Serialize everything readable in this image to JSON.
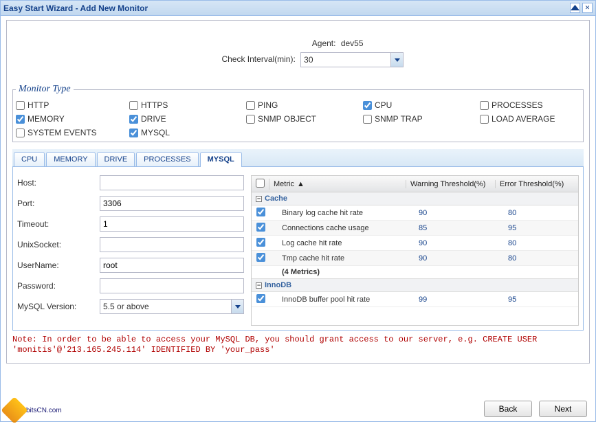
{
  "window": {
    "title": "Easy Start Wizard - Add New Monitor"
  },
  "agent": {
    "label": "Agent:",
    "value": "dev55",
    "interval_label": "Check Interval(min):",
    "interval_value": "30"
  },
  "monitor_type": {
    "legend": "Monitor Type",
    "items": [
      {
        "label": "HTTP",
        "checked": false
      },
      {
        "label": "HTTPS",
        "checked": false
      },
      {
        "label": "PING",
        "checked": false
      },
      {
        "label": "CPU",
        "checked": true
      },
      {
        "label": "PROCESSES",
        "checked": false
      },
      {
        "label": "MEMORY",
        "checked": true
      },
      {
        "label": "DRIVE",
        "checked": true
      },
      {
        "label": "SNMP OBJECT",
        "checked": false
      },
      {
        "label": "SNMP TRAP",
        "checked": false
      },
      {
        "label": "LOAD AVERAGE",
        "checked": false
      },
      {
        "label": "SYSTEM EVENTS",
        "checked": false
      },
      {
        "label": "MYSQL",
        "checked": true
      }
    ]
  },
  "tabs": [
    {
      "label": "CPU",
      "active": false
    },
    {
      "label": "MEMORY",
      "active": false
    },
    {
      "label": "DRIVE",
      "active": false
    },
    {
      "label": "PROCESSES",
      "active": false
    },
    {
      "label": "MYSQL",
      "active": true
    }
  ],
  "mysql_form": {
    "host": {
      "label": "Host:",
      "value": ""
    },
    "port": {
      "label": "Port:",
      "value": "3306"
    },
    "timeout": {
      "label": "Timeout:",
      "value": "1"
    },
    "unixsocket": {
      "label": "UnixSocket:",
      "value": ""
    },
    "username": {
      "label": "UserName:",
      "value": "root"
    },
    "password": {
      "label": "Password:",
      "value": ""
    },
    "version": {
      "label": "MySQL Version:",
      "value": "5.5 or above"
    }
  },
  "grid": {
    "headers": {
      "metric": "Metric",
      "warning": "Warning Threshold(%)",
      "error": "Error Threshold(%)"
    },
    "groups": [
      {
        "name": "Cache",
        "rows": [
          {
            "metric": "Binary log cache hit rate",
            "warn": "90",
            "err": "80",
            "checked": true
          },
          {
            "metric": "Connections cache usage",
            "warn": "85",
            "err": "95",
            "checked": true
          },
          {
            "metric": "Log cache hit rate",
            "warn": "90",
            "err": "80",
            "checked": true
          },
          {
            "metric": "Tmp cache hit rate",
            "warn": "90",
            "err": "80",
            "checked": true
          }
        ],
        "summary": "(4 Metrics)"
      },
      {
        "name": "InnoDB",
        "rows": [
          {
            "metric": "InnoDB buffer pool hit rate",
            "warn": "99",
            "err": "95",
            "checked": true
          }
        ]
      }
    ]
  },
  "note": "Note: In order to be able to access your MySQL DB, you should grant access to our server, e.g. CREATE USER 'monitis'@'213.165.245.114' IDENTIFIED BY 'your_pass'",
  "buttons": {
    "back": "Back",
    "next": "Next"
  },
  "watermark": "bitsCN.com"
}
